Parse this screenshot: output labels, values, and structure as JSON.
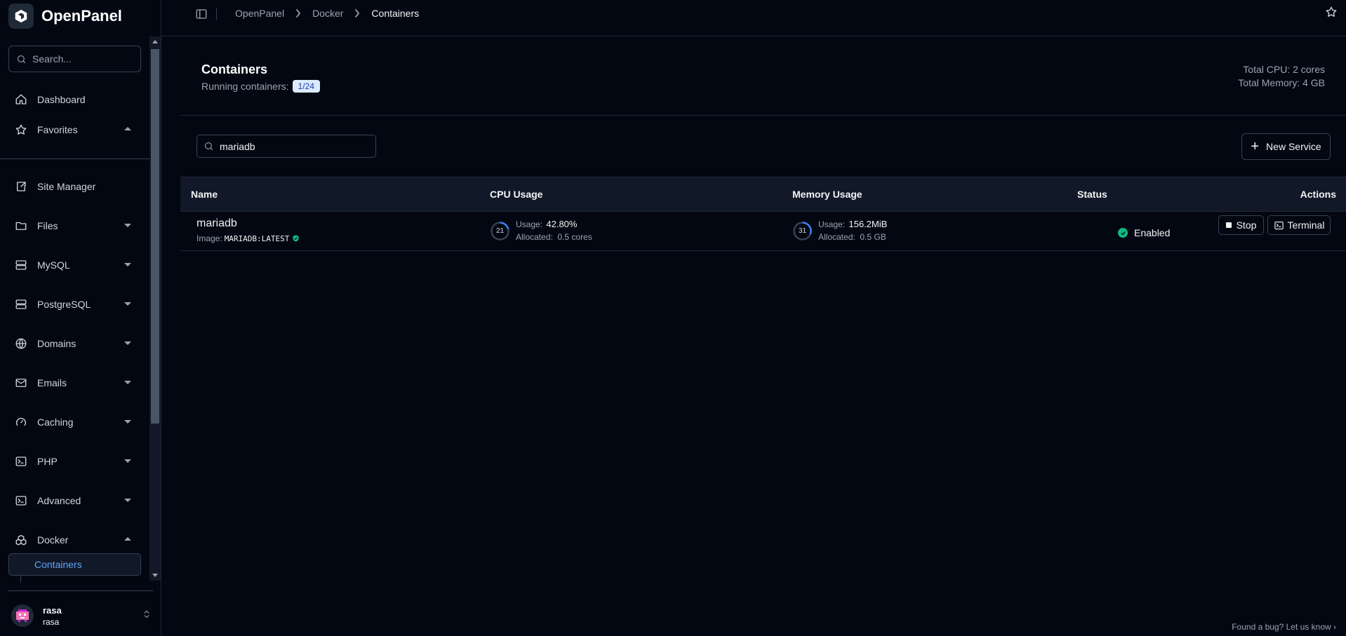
{
  "app": {
    "name": "OpenPanel"
  },
  "sidebar": {
    "search_placeholder": "Search...",
    "items": [
      {
        "label": "Dashboard",
        "icon": "home-icon"
      },
      {
        "label": "Favorites",
        "icon": "star-icon",
        "caret": "up"
      },
      {
        "label": "Site Manager",
        "icon": "site-manager-icon"
      },
      {
        "label": "Files",
        "icon": "folder-icon",
        "caret": "down"
      },
      {
        "label": "MySQL",
        "icon": "server-icon",
        "caret": "down"
      },
      {
        "label": "PostgreSQL",
        "icon": "server-icon",
        "caret": "down"
      },
      {
        "label": "Domains",
        "icon": "globe-icon",
        "caret": "down"
      },
      {
        "label": "Emails",
        "icon": "mail-icon",
        "caret": "down"
      },
      {
        "label": "Caching",
        "icon": "gauge-icon",
        "caret": "down"
      },
      {
        "label": "PHP",
        "icon": "terminal-square-icon",
        "caret": "down"
      },
      {
        "label": "Advanced",
        "icon": "terminal-square-icon",
        "caret": "down"
      },
      {
        "label": "Docker",
        "icon": "boxes-icon",
        "caret": "up"
      }
    ],
    "active_sub_item": "Containers",
    "user": {
      "name": "rasa",
      "username": "rasa"
    }
  },
  "topbar": {
    "breadcrumb": [
      "OpenPanel",
      "Docker",
      "Containers"
    ]
  },
  "header": {
    "title": "Containers",
    "running_label": "Running containers:",
    "running_badge": "1/24",
    "total_cpu": "Total CPU: 2 cores",
    "total_memory": "Total Memory: 4 GB"
  },
  "toolbar": {
    "filter_value": "mariadb",
    "new_service_label": "New Service"
  },
  "table": {
    "columns": [
      "Name",
      "CPU Usage",
      "Memory Usage",
      "Status",
      "Actions"
    ],
    "rows": [
      {
        "name": "mariadb",
        "image_label": "Image:",
        "image": "MARIADB:LATEST",
        "cpu": {
          "ring_value": "21",
          "ring_percent": 21,
          "usage_label": "Usage:",
          "usage": "42.80%",
          "allocated_label": "Allocated:",
          "allocated": "0.5 cores"
        },
        "memory": {
          "ring_value": "31",
          "ring_percent": 31,
          "usage_label": "Usage:",
          "usage": "156.2MiB",
          "allocated_label": "Allocated:",
          "allocated": "0.5 GB"
        },
        "status": "Enabled",
        "actions": {
          "stop": "Stop",
          "terminal": "Terminal"
        }
      }
    ]
  },
  "footer": {
    "bug_link": "Found a bug? Let us know"
  },
  "colors": {
    "accent": "#3b82f6",
    "status_enabled": "#10b981",
    "background": "#030712"
  }
}
